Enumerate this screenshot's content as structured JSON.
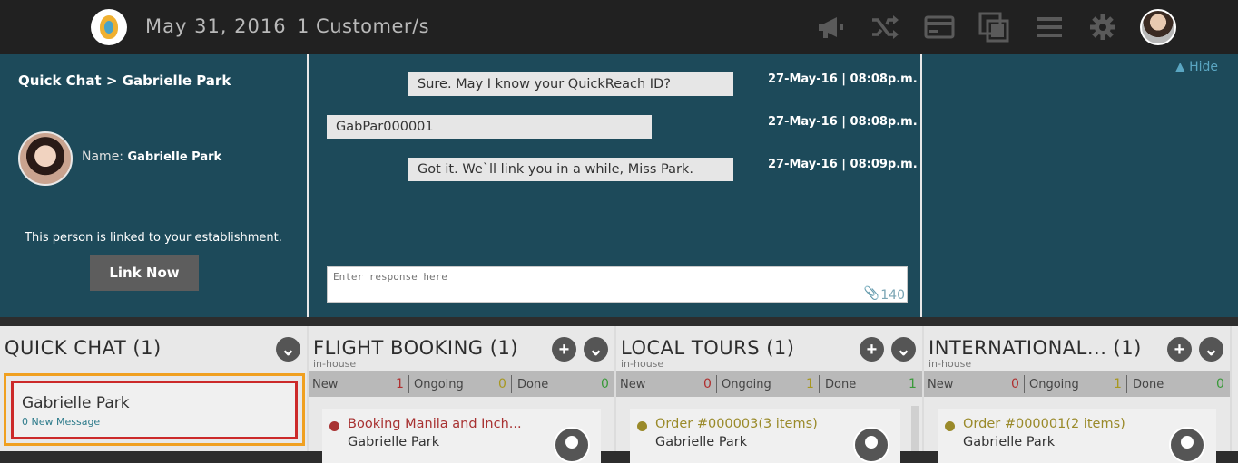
{
  "header": {
    "date": "May 31, 2016",
    "customers": "1 Customer/s",
    "icons": [
      "megaphone-icon",
      "shuffle-icon",
      "card-icon",
      "layers-icon",
      "menu-icon",
      "gear-icon"
    ]
  },
  "chat": {
    "breadcrumb": "Quick Chat > Gabrielle Park",
    "name_label": "Name:",
    "name_value": "Gabrielle Park",
    "linked_text": "This person is linked to your establishment.",
    "link_button": "Link Now",
    "hide_label": "Hide",
    "messages": [
      {
        "text": "Sure. May I know your QuickReach ID?",
        "time": "27-May-16 | 08:08p.m."
      },
      {
        "text": "GabPar000001",
        "time": "27-May-16 | 08:08p.m."
      },
      {
        "text": "Got it. We`ll link you in a while, Miss Park.",
        "time": "27-May-16 | 08:09p.m."
      }
    ],
    "response_placeholder": "Enter response here",
    "char_count": "140"
  },
  "board": {
    "quick_chat": {
      "title": "QUICK CHAT (1)",
      "card_name": "Gabrielle Park",
      "card_msg": "0 New Message"
    },
    "columns": [
      {
        "title": "FLIGHT BOOKING (1)",
        "sub": "in-house",
        "new_label": "New",
        "new_count": "1",
        "ongoing_label": "Ongoing",
        "ongoing_count": "0",
        "done_label": "Done",
        "done_count": "0",
        "card_title": "Booking Manila and Inch...",
        "card_name": "Gabrielle Park",
        "card_color": "#a83232"
      },
      {
        "title": "LOCAL TOURS (1)",
        "sub": "in-house",
        "new_label": "New",
        "new_count": "0",
        "ongoing_label": "Ongoing",
        "ongoing_count": "1",
        "done_label": "Done",
        "done_count": "1",
        "card_title": "Order #000003(3 items)",
        "card_name": "Gabrielle Park",
        "card_color": "#9a8a2a"
      },
      {
        "title": "INTERNATIONAL... (1)",
        "sub": "in-house",
        "new_label": "New",
        "new_count": "0",
        "ongoing_label": "Ongoing",
        "ongoing_count": "1",
        "done_label": "Done",
        "done_count": "0",
        "card_title": "Order #000001(2 items)",
        "card_name": "Gabrielle Park",
        "card_color": "#9a8a2a"
      }
    ]
  },
  "colors": {
    "topbar": "#212121",
    "chat_bg": "#1d4a5a",
    "new_count": "#b03030",
    "ongoing_count": "#a89820",
    "done_count": "#3a9a3a"
  }
}
